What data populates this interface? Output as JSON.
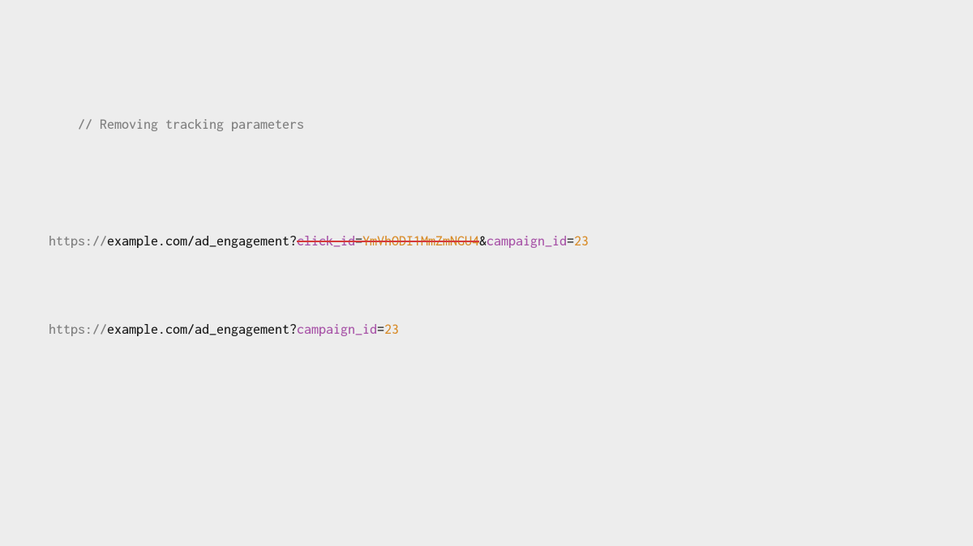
{
  "comment": "// Removing tracking parameters",
  "line1": {
    "protocol": "https://",
    "domainPath": "example.com/ad_engagement?",
    "struckParam": "click_id",
    "struckEq": "=",
    "struckVal": "YmVhODI1MmZmNGU4",
    "amp": "&",
    "param": "campaign_id",
    "eq": "=",
    "val": "23"
  },
  "line2": {
    "protocol": "https://",
    "domainPath": "example.com/ad_engagement?",
    "param": "campaign_id",
    "eq": "=",
    "val": "23"
  }
}
